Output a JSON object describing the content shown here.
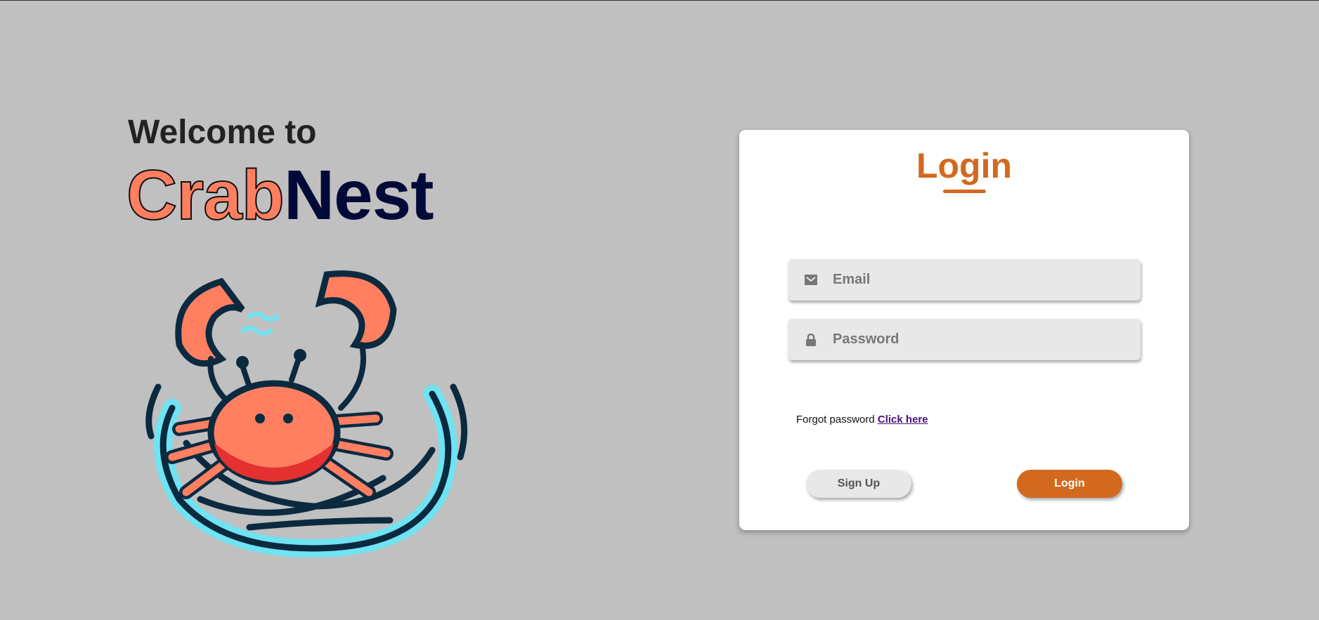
{
  "hero": {
    "welcome": "Welcome to",
    "brand_part1": "Crab",
    "brand_part2": "Nest",
    "logo_alt": "crab-in-nest-logo"
  },
  "login_card": {
    "title": "Login",
    "email_placeholder": "Email",
    "password_placeholder": "Password",
    "forgot_text": "Forgot password",
    "forgot_link": "Click here",
    "signup_label": "Sign Up",
    "login_label": "Login"
  },
  "colors": {
    "accent": "#d2691e",
    "brand_crab": "#ff7f60",
    "brand_nest": "#000a38",
    "background": "#c0c0c0"
  }
}
